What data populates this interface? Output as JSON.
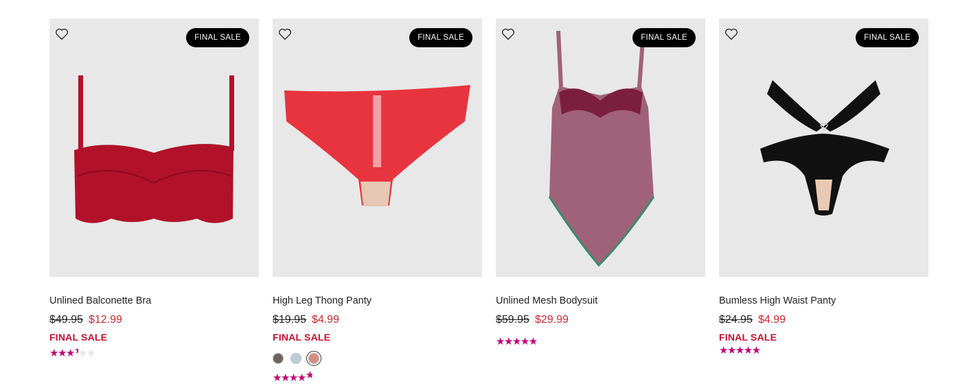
{
  "colors": {
    "sale_red": "#d0252e",
    "final_sale_red": "#c8102e",
    "star_pink": "#c4007a",
    "image_bg": "#e8e8e8"
  },
  "products": [
    {
      "name": "Unlined Balconette Bra",
      "badge": "FINAL SALE",
      "old_price": "$49.95",
      "sale_price": "$12.99",
      "final_sale_label": "FINAL SALE",
      "rating": 3.5
    },
    {
      "name": "High Leg Thong Panty",
      "badge": "FINAL SALE",
      "old_price": "$19.95",
      "sale_price": "$4.99",
      "final_sale_label": "FINAL SALE",
      "swatches": [
        "#6e645c",
        "#b9cfd8",
        "#d78d84"
      ],
      "selected_swatch": 2,
      "rating": 4.7
    },
    {
      "name": "Unlined Mesh Bodysuit",
      "badge": "FINAL SALE",
      "old_price": "$59.95",
      "sale_price": "$29.99",
      "final_sale_label": "",
      "rating": 5
    },
    {
      "name": "Bumless High Waist Panty",
      "badge": "FINAL SALE",
      "old_price": "$24.95",
      "sale_price": "$4.99",
      "final_sale_label": "FINAL SALE",
      "rating": 5
    }
  ]
}
